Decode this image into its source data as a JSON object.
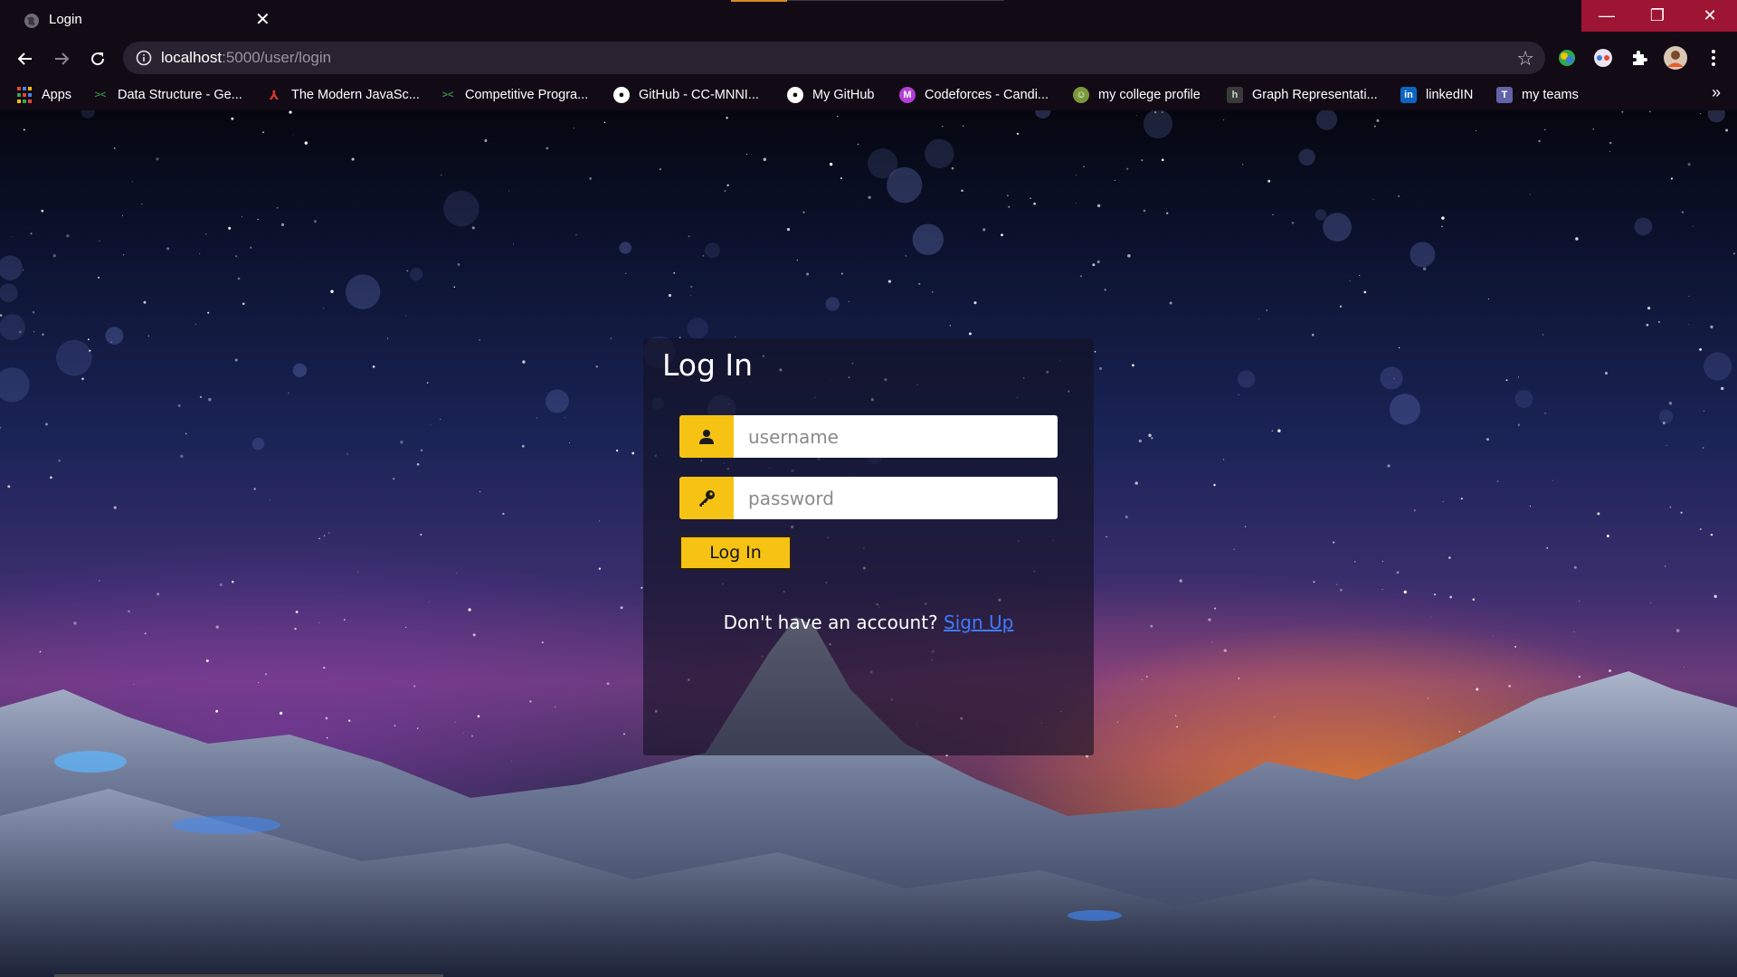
{
  "browser": {
    "tab_title": "Login",
    "tab_close": "✕",
    "window_controls": {
      "minimize": "—",
      "restore": "❐",
      "close": "✕"
    },
    "url_host": "localhost",
    "url_path": ":5000/user/login",
    "bookmarks": [
      {
        "label": "Apps",
        "icon": "apps-grid-icon",
        "color": "#ea4335"
      },
      {
        "label": "Data Structure - Ge...",
        "icon": "geeksforgeeks-icon",
        "color": "#2f8d46"
      },
      {
        "label": "The Modern JavaSc...",
        "icon": "javascript-info-icon",
        "color": "#d33a2c"
      },
      {
        "label": "Competitive Progra...",
        "icon": "geeksforgeeks-icon",
        "color": "#2f8d46"
      },
      {
        "label": "GitHub - CC-MNNI...",
        "icon": "github-icon",
        "color": "#ffffff"
      },
      {
        "label": "My GitHub",
        "icon": "github-icon",
        "color": "#ffffff"
      },
      {
        "label": "Codeforces - Candi...",
        "icon": "codeforces-icon",
        "color": "#b23fd6"
      },
      {
        "label": "my college profile",
        "icon": "college-icon",
        "color": "#7a9a3a"
      },
      {
        "label": "Graph Representati...",
        "icon": "hackerrank-icon",
        "color": "#3a3a3a"
      },
      {
        "label": "linkedIN",
        "icon": "linkedin-icon",
        "color": "#0a66c2"
      },
      {
        "label": "my teams",
        "icon": "teams-icon",
        "color": "#6264a7"
      }
    ],
    "bookmarks_more": "»"
  },
  "login": {
    "title": "Log In",
    "username_placeholder": "username",
    "password_placeholder": "password",
    "username_icon": "user-icon",
    "password_icon": "key-icon",
    "button_label": "Log In",
    "signup_prompt": "Don't have an account?",
    "signup_link": "Sign Up"
  },
  "colors": {
    "accent": "#f6c315",
    "link": "#3f7bff",
    "chrome_bg": "#120a15",
    "window_close_bg": "#9e1533"
  }
}
